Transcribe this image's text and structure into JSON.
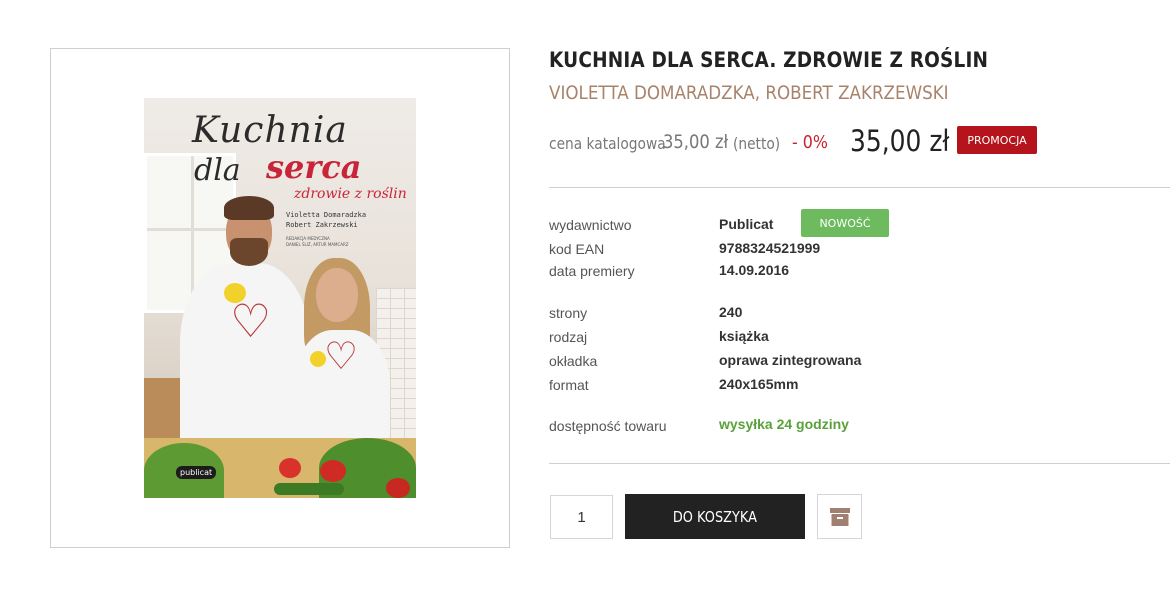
{
  "product": {
    "title": "KUCHNIA DLA SERCA. ZDROWIE Z ROŚLIN",
    "author": "VIOLETTA DOMARADZKA, ROBERT ZAKRZEWSKI"
  },
  "cover": {
    "title_line1": "Kuchnia",
    "title_line2a": "dla",
    "title_line2b": "serca",
    "subtitle": "zdrowie z roślin",
    "author1": "Violetta Domaradzka",
    "author2": "Robert Zakrzewski",
    "editorial_line1": "REDAKCJA MEDYCZNA",
    "editorial_line2": "DANIEL ŚLIŻ, ARTUR MAMCARZ",
    "publisher_logo": "publicat"
  },
  "price": {
    "catalog_label": "cena katalogowa",
    "catalog_value": "35,00 zł",
    "netto": "(netto)",
    "discount": "- 0%",
    "final": "35,00 zł",
    "promo_badge": "PROMOCJA"
  },
  "details": {
    "publisher_label": "wydawnictwo",
    "publisher_value": "Publicat",
    "new_badge": "NOWOŚĆ",
    "ean_label": "kod EAN",
    "ean_value": "9788324521999",
    "premiere_label": "data premiery",
    "premiere_value": "14.09.2016",
    "pages_label": "strony",
    "pages_value": "240",
    "type_label": "rodzaj",
    "type_value": "książka",
    "cover_label": "okładka",
    "cover_value": "oprawa zintegrowana",
    "format_label": "format",
    "format_value": "240x165mm",
    "availability_label": "dostępność towaru",
    "availability_value": "wysyłka 24 godziny"
  },
  "cart": {
    "quantity": "1",
    "button_label": "DO KOSZYKA",
    "archive_icon": "archive-box-icon"
  },
  "colors": {
    "author": "#a8826a",
    "discount": "#c8242f",
    "promo_badge": "#b5141c",
    "new_badge": "#6dbb5e",
    "availability": "#5aa13a",
    "cart_button": "#222222",
    "archive_icon": "#a08070"
  }
}
